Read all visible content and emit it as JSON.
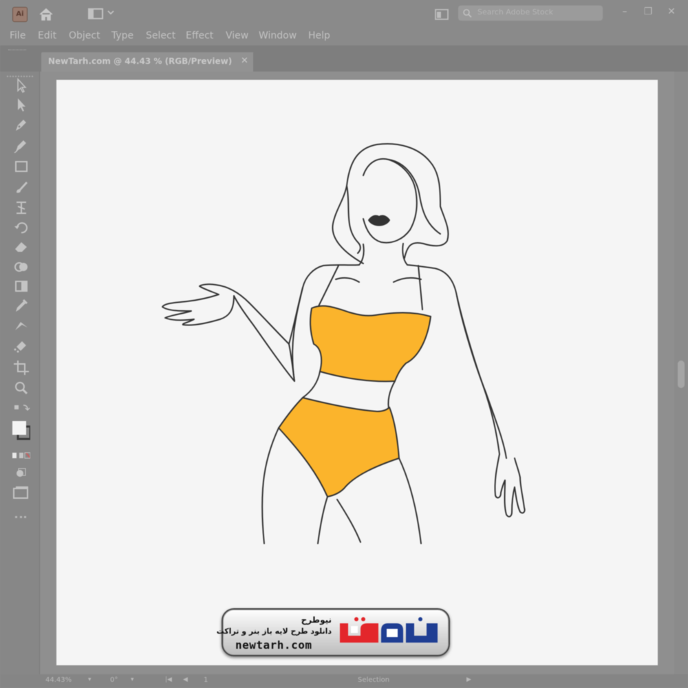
{
  "app": {
    "logo_text": "Ai",
    "search_placeholder": "Search Adobe Stock",
    "window_controls": [
      "–",
      "❐",
      "✕"
    ]
  },
  "menu": {
    "items": [
      "File",
      "Edit",
      "Object",
      "Type",
      "Select",
      "Effect",
      "View",
      "Window",
      "Help"
    ]
  },
  "document": {
    "tab_label": "NewTarh.com @ 44.43 % (RGB/Preview)",
    "close_label": "✕"
  },
  "toolbar": {
    "tools": [
      "selection-tool",
      "direct-selection-tool",
      "pen-tool",
      "curvature-tool",
      "rectangle-tool",
      "paintbrush-tool",
      "shaper-tool",
      "rotate-tool",
      "eraser-tool",
      "shape-builder-tool",
      "gradient-tool",
      "eyedropper-tool",
      "blend-tool",
      "symbol-sprayer-tool",
      "artboard-tool",
      "zoom-tool",
      "swap-colors",
      "fill-stroke",
      "draw-mode",
      "screen-mode",
      "edit-toolbar"
    ]
  },
  "status": {
    "zoom": "44.43%",
    "rotation": "0°",
    "artboard_number": "1",
    "tool_name": "Selection"
  },
  "watermark": {
    "title": "نیوطرح",
    "subtitle": "دانلود طرح لایه باز بنر و تراکت",
    "url": "newtarh.com",
    "logo_text": "نیوطرح"
  },
  "colors": {
    "bikini_fill": "#FBB42C",
    "line": "#333333",
    "artboard": "#F5F5F5",
    "logo_red": "#E3262B",
    "logo_blue": "#1F3E93"
  }
}
